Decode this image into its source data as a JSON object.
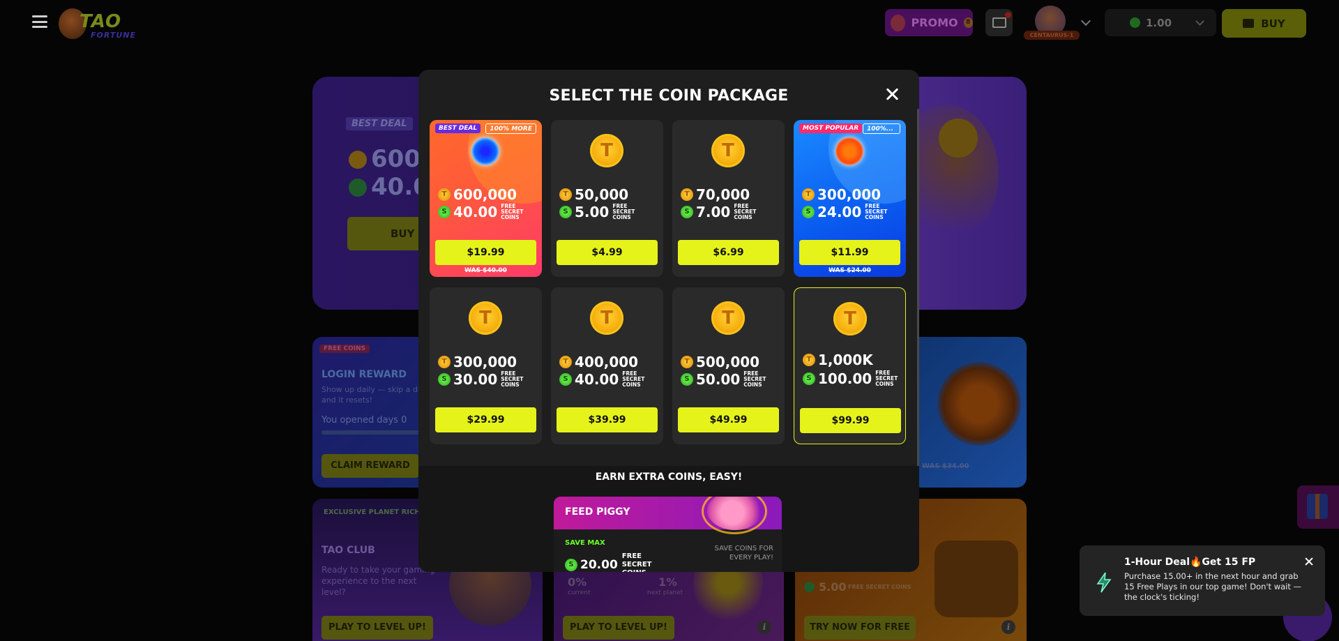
{
  "header": {
    "logo_main": "TAO",
    "logo_sub": "FORTUNE",
    "promo_label": "PROMO",
    "avatar_tag": "CENTAURUS-1",
    "balance": "1.00",
    "buy_label": "BUY"
  },
  "background": {
    "hero": {
      "tag": "BEST DEAL",
      "gold_value": "600",
      "secret_value": "40.0",
      "buy_label": "BUY N"
    },
    "login": {
      "tag": "FREE COINS",
      "title": "LOGIN REWARD",
      "desc": "Show up daily — skip a da and it resets!",
      "days_label": "You opened days   0",
      "claim_label": "CLAIM REWARD"
    },
    "right_card": {
      "was": "WAS $34.00"
    },
    "club": {
      "tag": "EXCLUSIVE PLANET RICHES",
      "title": "TAO CLUB",
      "desc": "Ready to take your gaming experience to the next level?",
      "button": "PLAY TO LEVEL UP!"
    },
    "level": {
      "pct_current": "0%",
      "label_current": "current",
      "pct_next": "1%",
      "label_next": "next planet",
      "button": "PLAY TO LEVEL UP!"
    },
    "chest": {
      "value": "5.00",
      "free_label": "FREE SECRET COINS",
      "button": "TRY NOW FOR FREE"
    }
  },
  "modal": {
    "title": "SELECT THE COIN PACKAGE",
    "packages": [
      {
        "badge_left": "BEST DEAL",
        "badge_right": "100% MORE",
        "gold": "600,000",
        "secret": "40.00",
        "free_label": "FREE SECRET COINS",
        "price": "$19.99",
        "was": "WAS $40.00",
        "icon": "blue-orb-icon"
      },
      {
        "gold": "50,000",
        "secret": "5.00",
        "free_label": "FREE SECRET COINS",
        "price": "$4.99",
        "icon": "coin-icon"
      },
      {
        "gold": "70,000",
        "secret": "7.00",
        "free_label": "FREE SECRET COINS",
        "price": "$6.99",
        "icon": "coin-icon"
      },
      {
        "badge_left": "MOST POPULAR",
        "badge_right": "100%...",
        "gold": "300,000",
        "secret": "24.00",
        "free_label": "FREE SECRET COINS",
        "price": "$11.99",
        "was": "WAS $24.00",
        "icon": "sun-orb-icon"
      },
      {
        "gold": "300,000",
        "secret": "30.00",
        "free_label": "FREE SECRET COINS",
        "price": "$29.99",
        "icon": "coin-icon"
      },
      {
        "gold": "400,000",
        "secret": "40.00",
        "free_label": "FREE SECRET COINS",
        "price": "$39.99",
        "icon": "coin-icon"
      },
      {
        "gold": "500,000",
        "secret": "50.00",
        "free_label": "FREE SECRET COINS",
        "price": "$49.99",
        "icon": "coin-icon"
      },
      {
        "gold": "1,000K",
        "secret": "100.00",
        "free_label": "FREE SECRET COINS",
        "price": "$99.99",
        "icon": "coin-icon"
      }
    ],
    "earn_title": "EARN EXTRA COINS, EASY!",
    "piggy": {
      "title": "FEED PIGGY",
      "save_label": "SAVE MAX",
      "value": "20.00",
      "free_label": "FREE SECRET COINS",
      "note": "SAVE COINS FOR EVERY PLAY!"
    }
  },
  "toast": {
    "title": "1-Hour Deal🔥Get 15 FP",
    "body": "Purchase 15.00+ in the next hour and grab 15 Free Plays in our top game! Don't wait — the clock's ticking!"
  },
  "colors": {
    "accent": "#e6f31a",
    "modal_bg": "#1e1e1e",
    "best_deal": "#ff5a3a",
    "most_popular": "#0a5aef"
  }
}
